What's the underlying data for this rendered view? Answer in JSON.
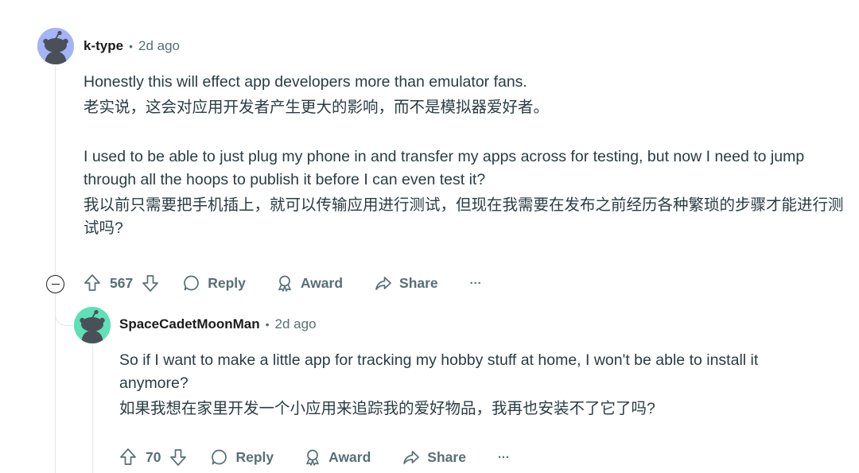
{
  "colors": {
    "avatar1_bg": "#a3b4f7",
    "avatar2_bg": "#5fe0b6",
    "muted": "#576f76",
    "text": "#2a3c42"
  },
  "comment": {
    "username": "k-type",
    "separator": "•",
    "time": "2d ago",
    "paragraphs": [
      "Honestly this will effect app developers more than emulator fans.",
      "老实说，这会对应用开发者产生更大的影响，而不是模拟器爱好者。",
      "I used to be able to just plug my phone in and transfer my apps across for testing, but now I need to jump through all the hoops to publish it before I can even test it?",
      "我以前只需要把手机插上，就可以传输应用进行测试，但现在我需要在发布之前经历各种繁琐的步骤才能进行测试吗?"
    ],
    "votes": "567",
    "reply_label": "Reply",
    "award_label": "Award",
    "share_label": "Share",
    "more_label": "···"
  },
  "reply": {
    "username": "SpaceCadetMoonMan",
    "separator": "•",
    "time": "2d ago",
    "paragraphs": [
      "So if I want to make a little app for tracking my hobby stuff at home, I won't be able to install it anymore?",
      "如果我想在家里开发一个小应用来追踪我的爱好物品，我再也安装不了它了吗?"
    ],
    "votes": "70",
    "reply_label": "Reply",
    "award_label": "Award",
    "share_label": "Share",
    "more_label": "···"
  }
}
